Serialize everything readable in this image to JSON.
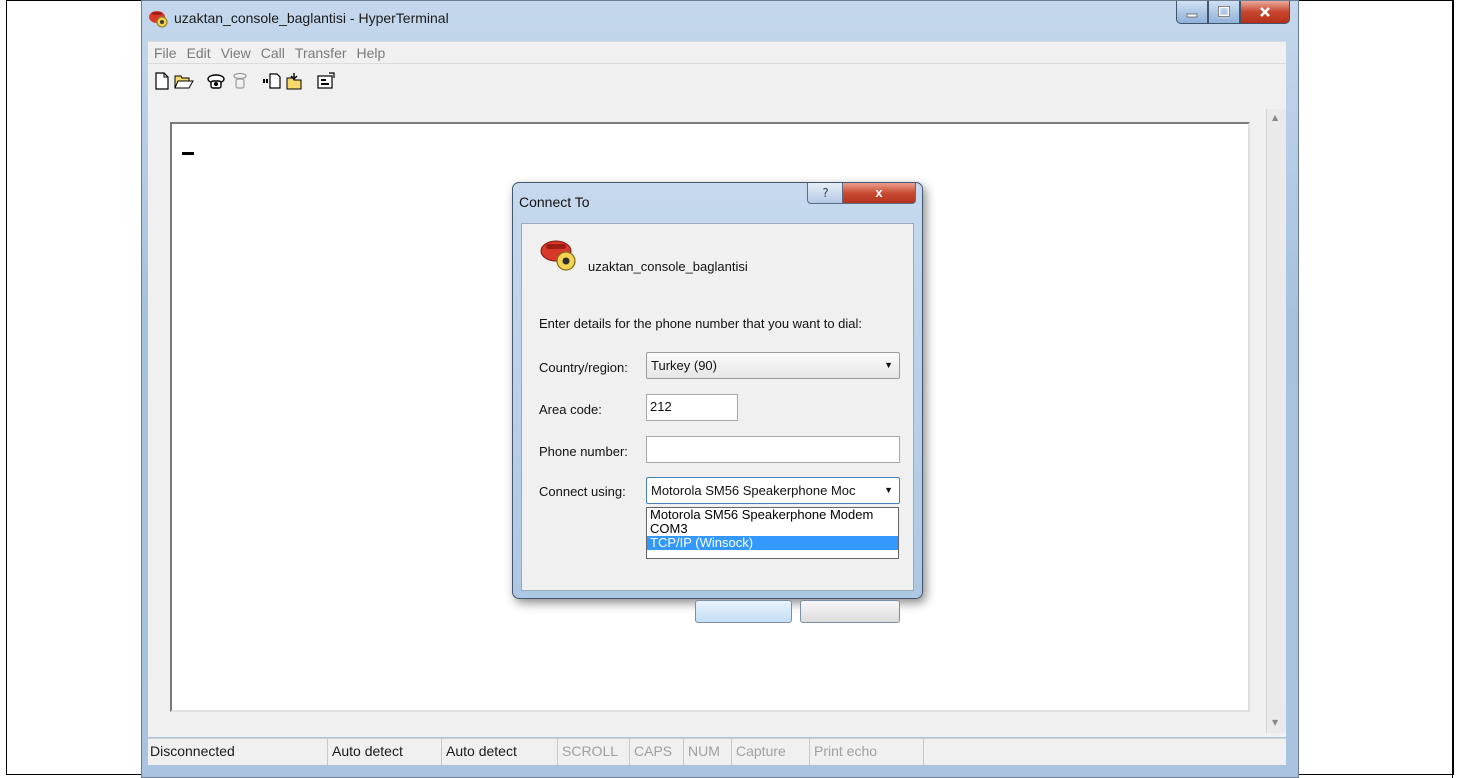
{
  "window": {
    "title": "uzaktan_console_baglantisi - HyperTerminal",
    "icon": "hyperterminal-icon",
    "controls": [
      "minimize",
      "maximize",
      "close"
    ]
  },
  "menu": [
    "File",
    "Edit",
    "View",
    "Call",
    "Transfer",
    "Help"
  ],
  "toolbar": [
    "new-icon",
    "open-icon",
    "call-icon",
    "disconnect-icon",
    "send-icon",
    "receive-icon",
    "properties-icon"
  ],
  "statusbar": {
    "connection": "Disconnected",
    "detect1": "Auto detect",
    "detect2": "Auto detect",
    "scroll": "SCROLL",
    "caps": "CAPS",
    "num": "NUM",
    "capture": "Capture",
    "print_echo": "Print echo"
  },
  "dialog": {
    "title": "Connect To",
    "help": "?",
    "close": "x",
    "connection_name": "uzaktan_console_baglantisi",
    "instructions": "Enter details for the phone number that you want to dial:",
    "country_label": "Country/region:",
    "country_value": "Turkey (90)",
    "area_label": "Area code:",
    "area_value": "212",
    "phone_label": "Phone number:",
    "phone_value": "",
    "connect_label": "Connect using:",
    "connect_value": "Motorola SM56 Speakerphone Moc",
    "options": [
      "Motorola SM56 Speakerphone Modem",
      "COM3",
      "TCP/IP (Winsock)"
    ],
    "selected_option": "TCP/IP (Winsock)"
  },
  "colors": {
    "window_frame": "#a9c3e0",
    "close_red": "#c6462d",
    "selection": "#3399ff"
  }
}
